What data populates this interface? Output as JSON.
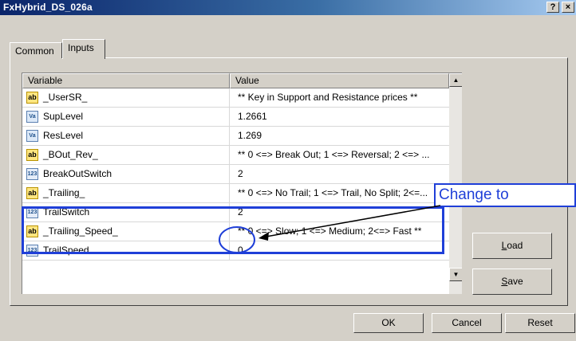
{
  "window": {
    "title": "FxHybrid_DS_026a",
    "help_label": "?",
    "close_label": "×"
  },
  "tabs": [
    {
      "label": "Common"
    },
    {
      "label": "Inputs"
    }
  ],
  "grid": {
    "headers": {
      "variable": "Variable",
      "value": "Value"
    },
    "rows": [
      {
        "icon": "ab",
        "name": "_UserSR_",
        "value": "** Key in Support and Resistance prices **"
      },
      {
        "icon": "Va",
        "name": "SupLevel",
        "value": "1.2661"
      },
      {
        "icon": "Va",
        "name": "ResLevel",
        "value": "1.269"
      },
      {
        "icon": "ab",
        "name": "_BOut_Rev_",
        "value": "** 0 <=> Break Out; 1 <=> Reversal; 2 <=> ..."
      },
      {
        "icon": "123",
        "name": "BreakOutSwitch",
        "value": "2"
      },
      {
        "icon": "ab",
        "name": "_Trailing_",
        "value": "** 0 <=> No Trail; 1 <=> Trail, No Split; 2<=..."
      },
      {
        "icon": "123",
        "name": "TrailSwitch",
        "value": "2"
      },
      {
        "icon": "ab",
        "name": "_Trailing_Speed_",
        "value": "** 0 <=> Slow; 1 <=> Medium; 2<=> Fast **"
      },
      {
        "icon": "123",
        "name": "TrailSpeed",
        "value": "0"
      }
    ]
  },
  "buttons": {
    "load_first": "L",
    "load_rest": "oad",
    "save_first": "S",
    "save_rest": "ave",
    "ok": "OK",
    "cancel": "Cancel",
    "reset": "Reset"
  },
  "annotation": {
    "callout_text": "Change to",
    "color": "#1f3fd8"
  }
}
